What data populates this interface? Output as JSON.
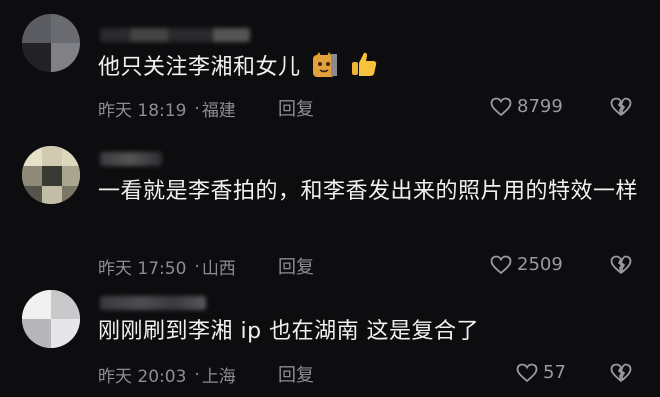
{
  "comments": [
    {
      "text": "他只关注李湘和女儿",
      "time": "昨天 18:19",
      "location": "福建",
      "reply_label": "回复",
      "likes": "8799",
      "emojis": [
        "cat-emoji",
        "thumbs-up-emoji"
      ]
    },
    {
      "text": "一看就是李香拍的，和李香发出来的照片用的特效一样",
      "time": "昨天 17:50",
      "location": "山西",
      "reply_label": "回复",
      "likes": "2509"
    },
    {
      "text": "刚刚刷到李湘 ip 也在湖南 这是复合了",
      "time": "昨天 20:03",
      "location": "上海",
      "reply_label": "回复",
      "likes": "57"
    }
  ],
  "colors": {
    "background": "#0d0d0f",
    "text": "#f1f1f1",
    "meta": "#8d8d93"
  },
  "icons": [
    "heart-outline-icon",
    "broken-heart-icon"
  ]
}
